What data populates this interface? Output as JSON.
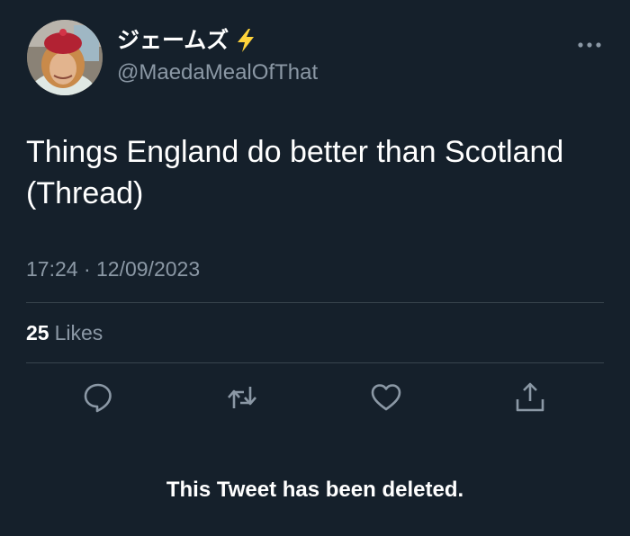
{
  "author": {
    "display_name": "ジェームズ",
    "badge_icon": "lightning-bolt-icon",
    "handle": "@MaedaMealOfThat"
  },
  "tweet": {
    "text": "Things England do better than Scotland (Thread)",
    "timestamp": "17:24 · 12/09/2023"
  },
  "stats": {
    "likes_count": "25",
    "likes_label": "Likes"
  },
  "actions": {
    "reply_icon": "reply-icon",
    "retweet_icon": "retweet-icon",
    "like_icon": "heart-icon",
    "share_icon": "share-icon"
  },
  "notice": {
    "text": "This Tweet has been deleted."
  },
  "colors": {
    "background": "#15202b",
    "secondary_text": "#8b98a5",
    "divider": "#38444d",
    "bolt": "#ffd43b"
  }
}
